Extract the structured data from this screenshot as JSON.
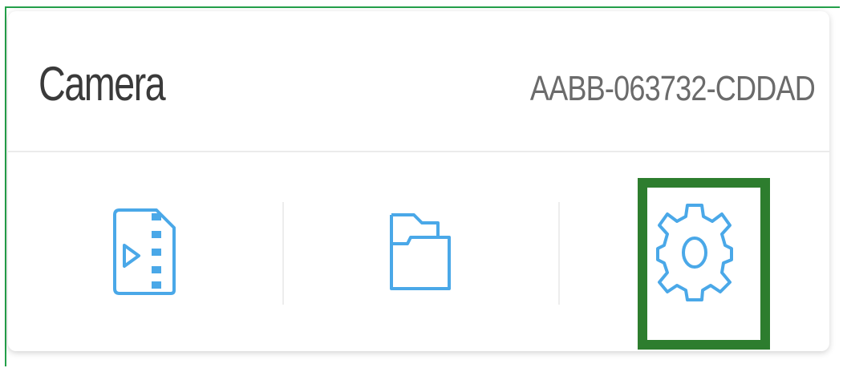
{
  "camera_card": {
    "title": "Camera",
    "device_id": "AABB-063732-CDDAD"
  },
  "actions": [
    {
      "icon": "sd-card-video-icon"
    },
    {
      "icon": "folder-icon"
    },
    {
      "icon": "gear-icon"
    }
  ],
  "colors": {
    "icon_blue": "#4aa8e8",
    "highlight_green": "#2d7d2e",
    "frame_green": "#24a04a"
  }
}
